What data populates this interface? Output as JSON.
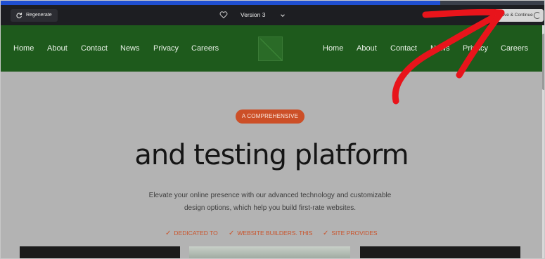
{
  "toolbar": {
    "regenerate_label": "Regenerate",
    "version_label": "Version 3",
    "save_label": "Save & Continue"
  },
  "site_nav": {
    "left_links": [
      "Home",
      "About",
      "Contact",
      "News",
      "Privacy",
      "Careers"
    ],
    "right_links": [
      "Home",
      "About",
      "Contact",
      "News",
      "Privacy",
      "Careers"
    ]
  },
  "hero": {
    "badge": "A COMPREHENSIVE",
    "title": "and testing platform",
    "description": "Elevate your online presence with our advanced technology and customizable design options, which help you build first-rate websites.",
    "features": [
      "DEDICATED TO",
      "WEBSITE BUILDERS. THIS",
      "SITE PROVIDES"
    ]
  },
  "colors": {
    "nav_green": "#1e5a1c",
    "badge_orange": "#cc4f27",
    "annotation_red": "#e8141b",
    "toolbar_dark": "#1d1e22"
  },
  "icons": {
    "regenerate": "refresh-icon",
    "favorite": "heart-icon",
    "version_dropdown": "chevron-down-icon",
    "save_status": "spinner-icon"
  }
}
